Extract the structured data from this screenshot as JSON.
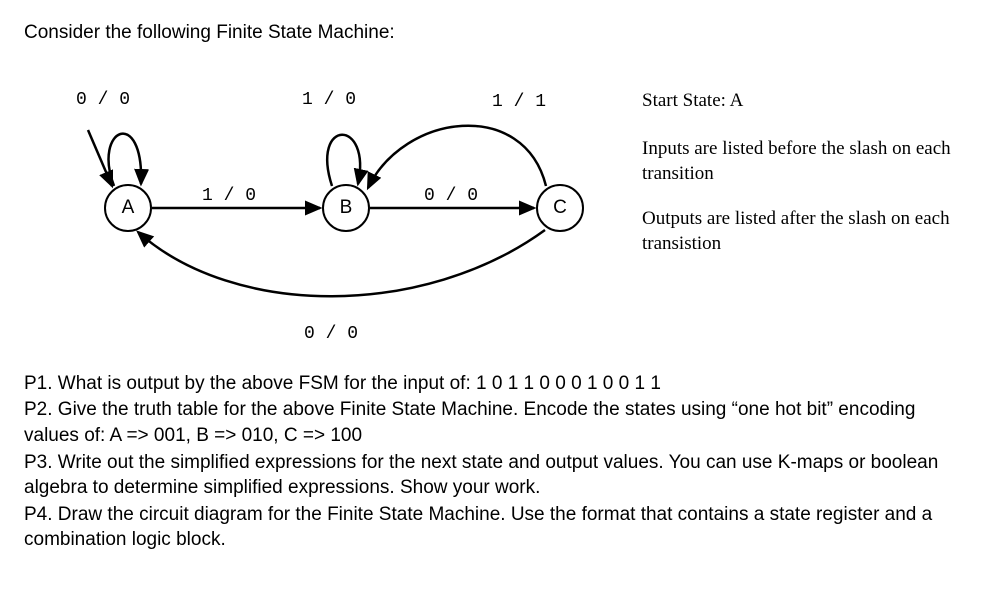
{
  "intro": "Consider the following Finite State Machine:",
  "fsm": {
    "states": {
      "A": "A",
      "B": "B",
      "C": "C"
    },
    "transitions": {
      "a_self": "0 / 0",
      "a_to_b": "1 / 0",
      "b_self": "1 / 0",
      "b_to_c": "0 / 0",
      "c_self": "1 / 1",
      "c_to_a": "0 / 0"
    },
    "notes": {
      "start": "Start State: A",
      "inputs": "Inputs are listed before the slash on each transition",
      "outputs": "Outputs are listed after the slash on each transistion"
    }
  },
  "questions": {
    "p1": "P1. What is output by the above FSM for the input of: 1 0 1 1 0 0 0 1 0 0 1 1",
    "p2": "P2. Give the truth table for the above Finite State Machine. Encode the states using “one hot bit” encoding values of: A => 001, B => 010, C => 100",
    "p3": "P3. Write out the simplified expressions for the next state and output values. You can use K-maps or boolean algebra to determine simplified expressions. Show your work.",
    "p4": "P4. Draw the circuit diagram for the Finite State Machine. Use the format that contains a state register and a combination logic block."
  },
  "chart_data": {
    "type": "state-diagram",
    "title": "Finite State Machine",
    "start_state": "A",
    "states": [
      "A",
      "B",
      "C"
    ],
    "transitions": [
      {
        "from": "A",
        "to": "A",
        "input": "0",
        "output": "0"
      },
      {
        "from": "A",
        "to": "B",
        "input": "1",
        "output": "0"
      },
      {
        "from": "B",
        "to": "B",
        "input": "1",
        "output": "0"
      },
      {
        "from": "B",
        "to": "C",
        "input": "0",
        "output": "0"
      },
      {
        "from": "C",
        "to": "C",
        "input": "1",
        "output": "1"
      },
      {
        "from": "C",
        "to": "A",
        "input": "0",
        "output": "0"
      }
    ],
    "encoding": {
      "A": "001",
      "B": "010",
      "C": "100"
    }
  }
}
